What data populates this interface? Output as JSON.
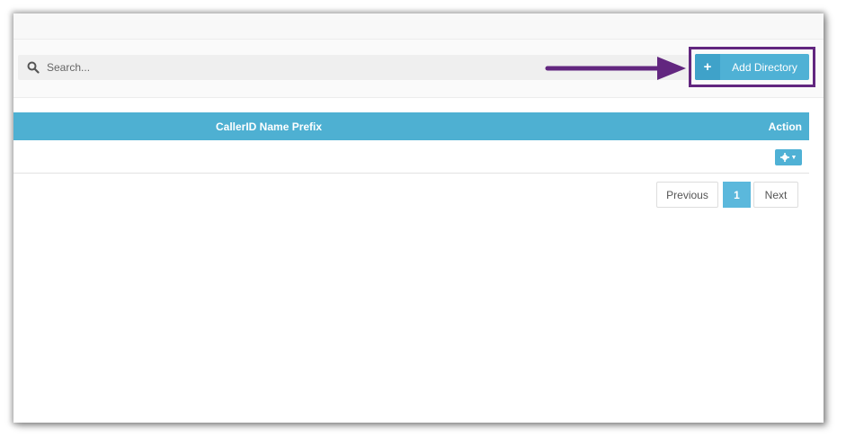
{
  "search": {
    "placeholder": "Search..."
  },
  "toolbar": {
    "add_label": "Add Directory",
    "add_icon": "+"
  },
  "table": {
    "columns": [
      "CallerID Name Prefix",
      "Action"
    ],
    "rows": [
      {
        "caller_id_name_prefix": "",
        "action_icon": "gear-icon"
      }
    ]
  },
  "pagination": {
    "previous": "Previous",
    "current": "1",
    "next": "Next"
  },
  "colors": {
    "accent": "#4eb0d2",
    "highlight": "#62267f"
  }
}
